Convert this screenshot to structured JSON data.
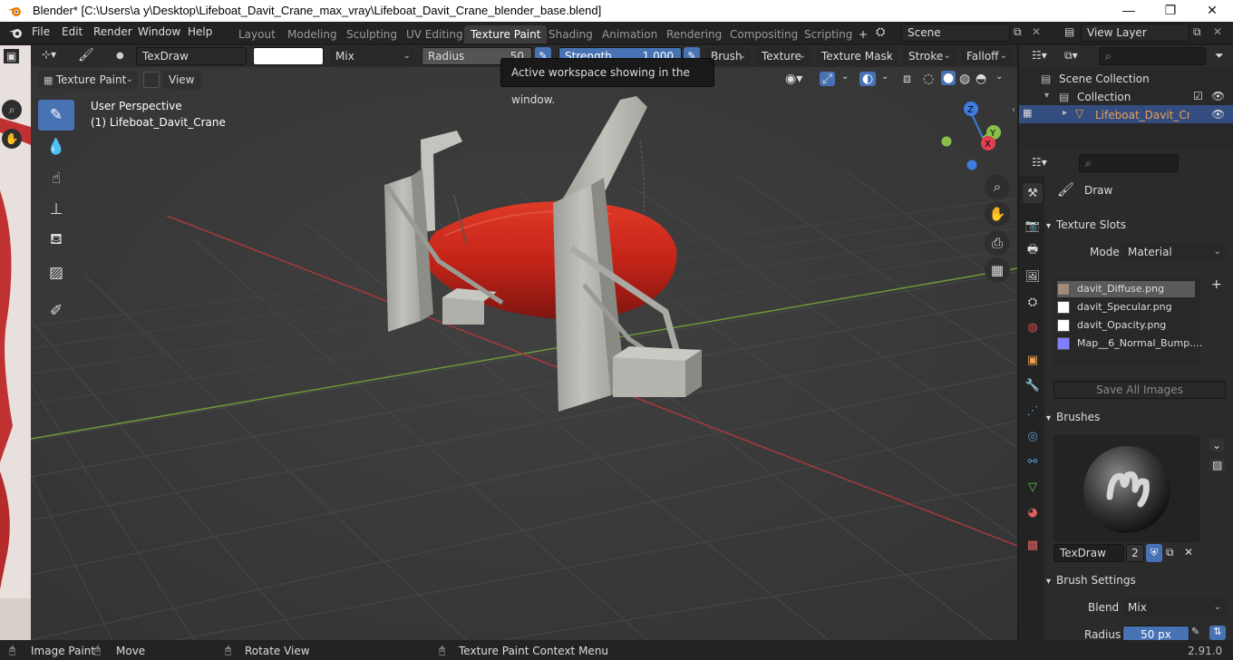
{
  "window": {
    "title": "Blender* [C:\\Users\\a y\\Desktop\\Lifeboat_Davit_Crane_max_vray\\Lifeboat_Davit_Crane_blender_base.blend]",
    "controls": [
      "—",
      "❐",
      "✕"
    ]
  },
  "menus": [
    "File",
    "Edit",
    "Render",
    "Window",
    "Help"
  ],
  "workspaces": [
    {
      "label": "Layout",
      "active": false
    },
    {
      "label": "Modeling",
      "active": false
    },
    {
      "label": "Sculpting",
      "active": false
    },
    {
      "label": "UV Editing",
      "active": false
    },
    {
      "label": "Texture Paint",
      "active": true
    },
    {
      "label": "Shading",
      "active": false
    },
    {
      "label": "Animation",
      "active": false
    },
    {
      "label": "Rendering",
      "active": false
    },
    {
      "label": "Compositing",
      "active": false
    },
    {
      "label": "Scripting",
      "active": false
    }
  ],
  "add_workspace": "+",
  "scene": {
    "label": "Scene",
    "view_layer": "View Layer"
  },
  "tool_header": {
    "brush_name": "TexDraw",
    "blend_mode": "Mix",
    "radius_label": "Radius",
    "radius_value": "50",
    "strength_label": "Strength",
    "strength_value": "1.000",
    "menus": [
      "Brush",
      "Texture",
      "Texture Mask",
      "Stroke",
      "Falloff"
    ]
  },
  "viewport_header": {
    "mode": "Texture Paint",
    "view_menu": "View"
  },
  "tooltip": "Active workspace showing in the window.",
  "viewport": {
    "perspective": "User Perspective",
    "object_label": "(1) Lifeboat_Davit_Crane",
    "gizmo_axes": [
      "Z",
      "Y",
      "X"
    ]
  },
  "tools": [
    "draw-brush",
    "soften-brush",
    "smear-brush",
    "clone-brush",
    "fill-brush",
    "mask-brush",
    "annotate"
  ],
  "outliner": {
    "root": "Scene Collection",
    "collection": "Collection",
    "object": "Lifeboat_Davit_Crane"
  },
  "properties": {
    "active_tool": "Draw",
    "texture_slots_title": "Texture Slots",
    "mode_label": "Mode",
    "mode_value": "Material",
    "slots": [
      {
        "name": "davit_Diffuse.png",
        "color": "#a08a7a",
        "selected": true
      },
      {
        "name": "davit_Specular.png",
        "color": "#ffffff",
        "selected": false
      },
      {
        "name": "davit_Opacity.png",
        "color": "#ffffff",
        "selected": false
      },
      {
        "name": "Map__6_Normal_Bump....",
        "color": "#8080ff",
        "selected": false
      }
    ],
    "save_all": "Save All Images",
    "brushes_title": "Brushes",
    "brush_name": "TexDraw",
    "brush_users": "2",
    "brush_settings_title": "Brush Settings",
    "blend_label": "Blend",
    "blend_value": "Mix",
    "radius_label": "Radius",
    "radius_value": "50 px"
  },
  "statusbar": {
    "items": [
      "Image Paint",
      "Move",
      "Rotate View",
      "Texture Paint Context Menu"
    ],
    "version": "2.91.0"
  },
  "colors": {
    "accent": "#4772b3",
    "lifeboat": "#c8291c",
    "grid_x": "#a8393d",
    "grid_y": "#6e9a3a",
    "crane": "#b8b8b2"
  }
}
